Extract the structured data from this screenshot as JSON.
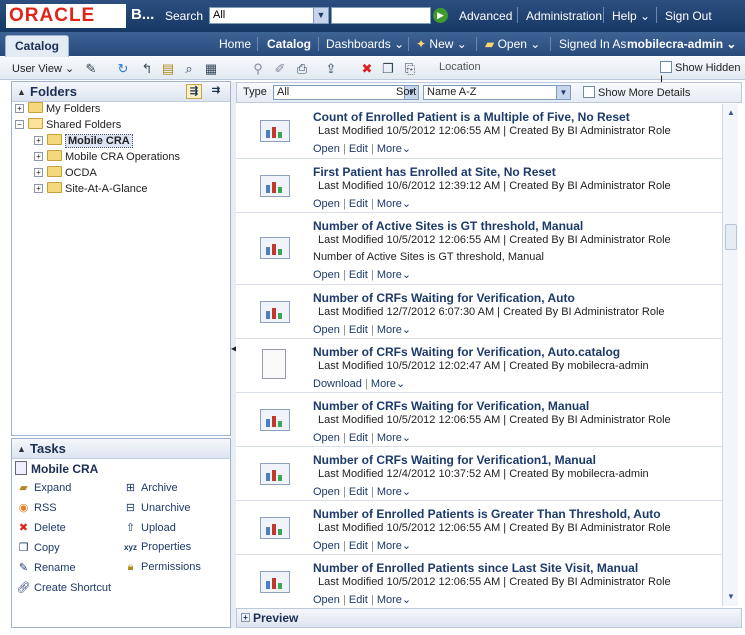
{
  "header": {
    "logo": "ORACLE",
    "app_name": "B...",
    "search_label": "Search",
    "search_scope": "All",
    "links": [
      "Advanced",
      "Administration",
      "Help",
      "Sign Out"
    ]
  },
  "nav": {
    "active_tab": "Catalog",
    "items": [
      "Home",
      "Catalog",
      "Dashboards",
      "New",
      "Open"
    ],
    "signed_in_label": "Signed In As",
    "username": "mobilecra-admin"
  },
  "toolbar": {
    "user_view": "User View",
    "location_label": "Location",
    "show_hidden": "Show Hidden I"
  },
  "folders": {
    "title": "Folders",
    "items": [
      {
        "label": "My Folders"
      },
      {
        "label": "Shared Folders"
      },
      {
        "label": "Mobile CRA"
      },
      {
        "label": "Mobile CRA Operations"
      },
      {
        "label": "OCDA"
      },
      {
        "label": "Site-At-A-Glance"
      }
    ]
  },
  "tasks": {
    "title": "Tasks",
    "selected": "Mobile CRA",
    "left": [
      "Expand",
      "RSS",
      "Delete",
      "Copy",
      "Rename",
      "Create Shortcut"
    ],
    "right": [
      "Archive",
      "Unarchive",
      "Upload",
      "Properties",
      "Permissions"
    ]
  },
  "filter": {
    "type_label": "Type",
    "type_value": "All",
    "sort_label": "Sort",
    "sort_value": "Name A-Z",
    "show_more_details": "Show More Details"
  },
  "items": [
    {
      "title": "Count of Enrolled Patient is a Multiple of Five, No Reset",
      "modified": "Last Modified 10/5/2012 12:06:55 AM",
      "created": "Created By BI Administrator Role",
      "actions": [
        "Open",
        "Edit",
        "More"
      ]
    },
    {
      "title": "First Patient has Enrolled at Site, No Reset",
      "modified": "Last Modified 10/6/2012 12:39:12 AM",
      "created": "Created By BI Administrator Role",
      "actions": [
        "Open",
        "Edit",
        "More"
      ]
    },
    {
      "title": "Number of Active Sites is GT threshold, Manual",
      "modified": "Last Modified 10/5/2012 12:06:55 AM",
      "created": "Created By BI Administrator Role",
      "desc": "Number of Active Sites is GT threshold, Manual",
      "actions": [
        "Open",
        "Edit",
        "More"
      ]
    },
    {
      "title": "Number of CRFs Waiting for Verification, Auto",
      "modified": "Last Modified 12/7/2012 6:07:30 AM",
      "created": "Created By BI Administrator Role",
      "actions": [
        "Open",
        "Edit",
        "More"
      ]
    },
    {
      "title": "Number of CRFs Waiting for Verification, Auto.catalog",
      "modified": "Last Modified 10/5/2012 12:02:47 AM",
      "created": "Created By mobilecra-admin",
      "actions": [
        "Download",
        "More"
      ]
    },
    {
      "title": "Number of CRFs Waiting for Verification, Manual",
      "modified": "Last Modified 10/5/2012 12:06:55 AM",
      "created": "Created By BI Administrator Role",
      "actions": [
        "Open",
        "Edit",
        "More"
      ]
    },
    {
      "title": "Number of CRFs Waiting for Verification1, Manual",
      "modified": "Last Modified 12/4/2012 10:37:52 AM",
      "created": "Created By mobilecra-admin",
      "actions": [
        "Open",
        "Edit",
        "More"
      ]
    },
    {
      "title": "Number of Enrolled Patients is Greater Than Threshold, Auto",
      "modified": "Last Modified 10/5/2012 12:06:55 AM",
      "created": "Created By BI Administrator Role",
      "actions": [
        "Open",
        "Edit",
        "More"
      ]
    },
    {
      "title": "Number of Enrolled Patients since Last Site Visit, Manual",
      "modified": "Last Modified 10/5/2012 12:06:55 AM",
      "created": "Created By BI Administrator Role",
      "actions": [
        "Open",
        "Edit",
        "More"
      ]
    }
  ],
  "preview": {
    "label": "Preview"
  }
}
